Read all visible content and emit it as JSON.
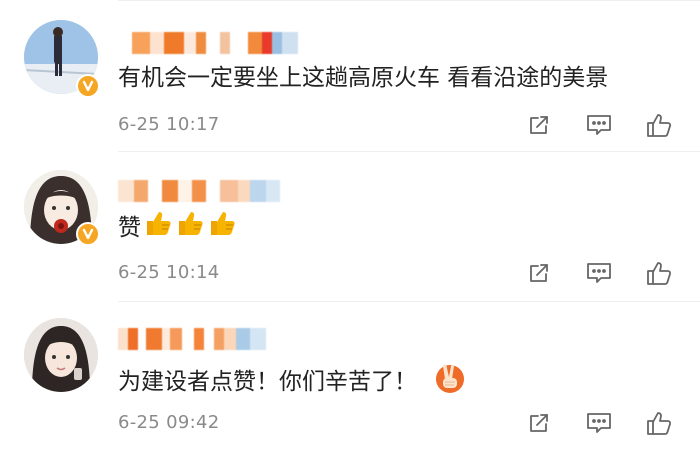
{
  "comments": [
    {
      "username": "",
      "text": "有机会一定要坐上这趟高原火车 看看沿途的美景",
      "time": "6-25 10:17",
      "emojis": []
    },
    {
      "username": "",
      "text": "赞",
      "time": "6-25 10:14",
      "emojis": [
        "thumbs-up",
        "thumbs-up",
        "thumbs-up"
      ]
    },
    {
      "username": "",
      "text": "为建设者点赞！你们辛苦了！",
      "time": "6-25 09:42",
      "emojis": [
        "victory-hand"
      ]
    }
  ],
  "icons": {
    "share": "share-icon",
    "reply": "comment-icon",
    "like": "like-icon"
  },
  "colors": {
    "timestamp": "#8a8a8a",
    "icon": "#666666",
    "badge": "#f5a623",
    "divider": "#eeeeee",
    "emoji": "#f6b400"
  }
}
